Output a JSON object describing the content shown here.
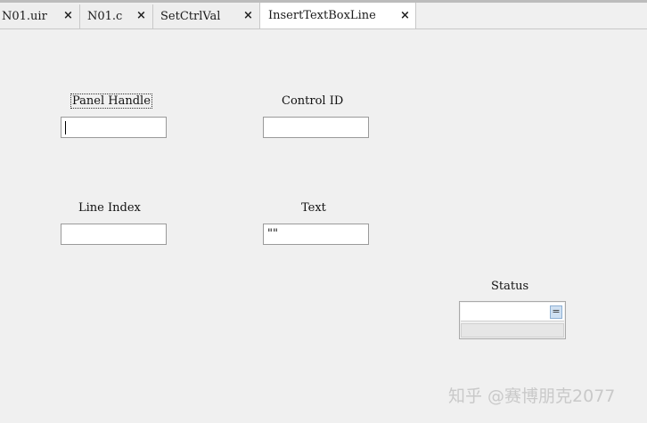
{
  "tabs": [
    {
      "label": "N01.uir",
      "close": "×"
    },
    {
      "label": "N01.c",
      "close": "×"
    },
    {
      "label": "SetCtrlVal",
      "close": "×"
    },
    {
      "label": "InsertTextBoxLine",
      "close": "×"
    }
  ],
  "panel": {
    "panel_handle": {
      "label": "Panel Handle",
      "value": ""
    },
    "control_id": {
      "label": "Control ID",
      "value": ""
    },
    "line_index": {
      "label": "Line Index",
      "value": ""
    },
    "text": {
      "label": "Text",
      "value": "\"\""
    },
    "status": {
      "label": "Status",
      "button": "="
    }
  },
  "watermark": "知乎 @赛博朋克2077"
}
